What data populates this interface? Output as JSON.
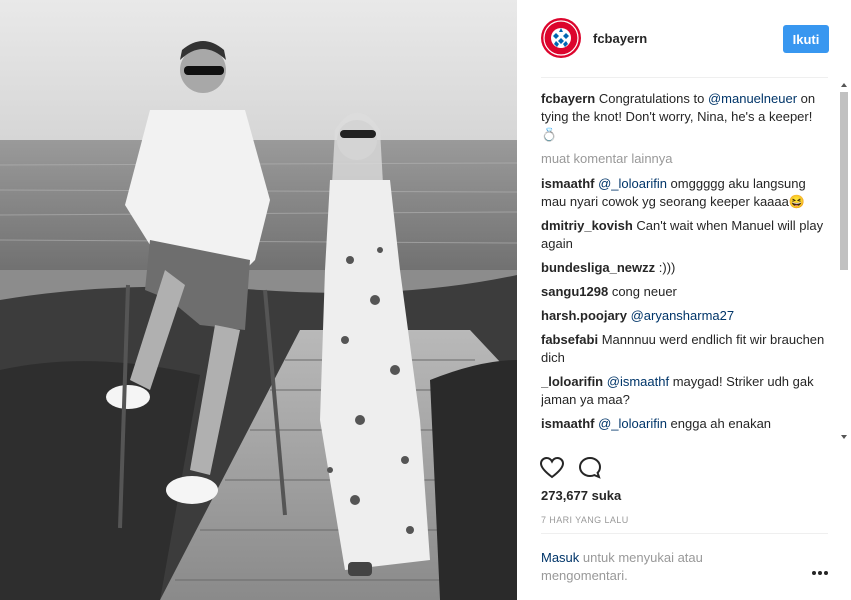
{
  "post": {
    "username": "fcbayern",
    "follow_label": "Ikuti",
    "caption": {
      "username": "fcbayern",
      "text_before": "Congratulations to ",
      "mention": "@manuelneuer",
      "text_after": " on tying the knot! Don't worry, Nina, he's a keeper! 💍"
    },
    "load_more": "muat komentar lainnya",
    "comments": [
      {
        "user": "ismaathf",
        "mention": "@_loloarifin",
        "text": " omggggg aku langsung mau nyari cowok yg seorang keeper kaaaa😆"
      },
      {
        "user": "dmitriy_kovish",
        "mention": "",
        "text": "Can't wait when Manuel will play again"
      },
      {
        "user": "bundesliga_newzz",
        "mention": "",
        "text": ":)))"
      },
      {
        "user": "sangu1298",
        "mention": "",
        "text": "cong neuer"
      },
      {
        "user": "harsh.poojary",
        "mention": "@aryansharma27",
        "text": ""
      },
      {
        "user": "fabsefabi",
        "mention": "",
        "text": "Mannnuu werd endlich fit wir brauchen dich"
      },
      {
        "user": "_loloarifin",
        "mention": "@ismaathf",
        "text": " maygad! Striker udh gak jaman ya maa?"
      },
      {
        "user": "ismaathf",
        "mention": "@_loloarifin",
        "text": " engga ah enakan"
      }
    ],
    "likes": "273,677 suka",
    "time": "7 HARI YANG LALU",
    "login_link": "Masuk",
    "login_text": " untuk menyukai atau mengomentari."
  },
  "icons": {
    "like": "heart-icon",
    "comment": "speech-bubble-icon",
    "more": "more-options-icon",
    "avatar": "fc-bayern-logo"
  },
  "colors": {
    "follow_button": "#3897f0",
    "link": "#003569",
    "muted": "#999999",
    "bayern_red": "#dc052d",
    "bayern_blue": "#0066b2"
  }
}
